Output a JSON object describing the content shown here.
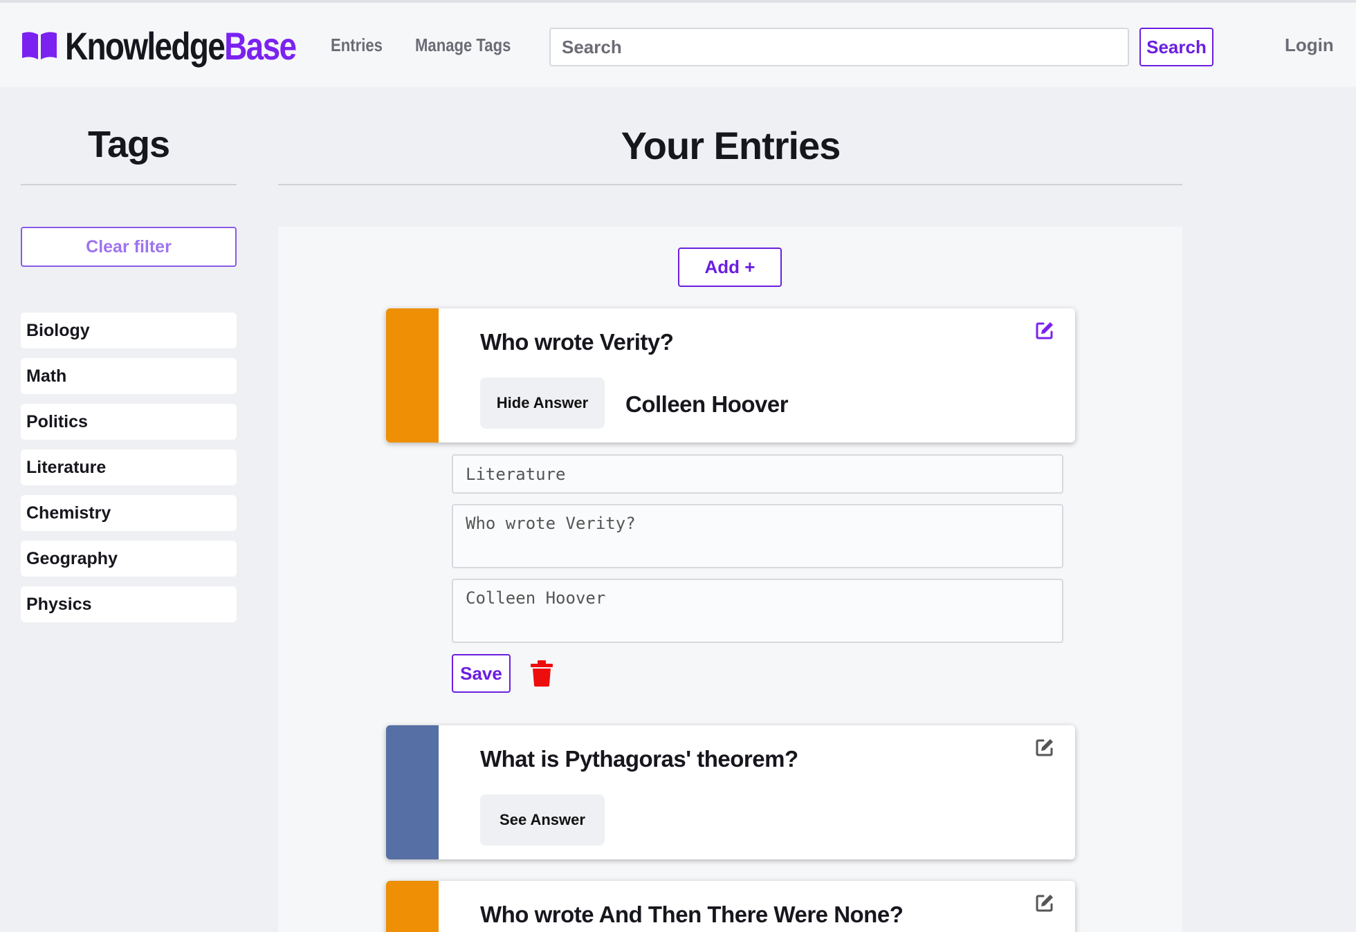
{
  "app": {
    "logo_part1": "Knowledge",
    "logo_part2": "Base",
    "brand_color": "#7b22f0"
  },
  "nav": {
    "entries": "Entries",
    "manage_tags": "Manage Tags",
    "search_placeholder": "Search",
    "search_button": "Search",
    "login": "Login"
  },
  "sidebar": {
    "title": "Tags",
    "clear_filter": "Clear filter",
    "tags": [
      "Biology",
      "Math",
      "Politics",
      "Literature",
      "Chemistry",
      "Geography",
      "Physics"
    ]
  },
  "main": {
    "title": "Your Entries",
    "add_button": "Add +",
    "entries": [
      {
        "question": "Who wrote Verity?",
        "button": "Hide Answer",
        "answer": "Colleen Hoover",
        "color": "#ef8f06"
      },
      {
        "question": "What is Pythagoras' theorem?",
        "button": "See Answer",
        "color": "#566fa4"
      },
      {
        "question": "Who wrote And Then There Were None?",
        "color": "#ef8f06"
      }
    ],
    "edit_form": {
      "tag_value": "Literature",
      "question_value": "Who wrote Verity?",
      "answer_value": "Colleen Hoover",
      "save_button": "Save"
    }
  },
  "icons": {
    "logo": "book-open-icon",
    "edit": "pen-to-square-icon",
    "delete": "trash-icon"
  }
}
